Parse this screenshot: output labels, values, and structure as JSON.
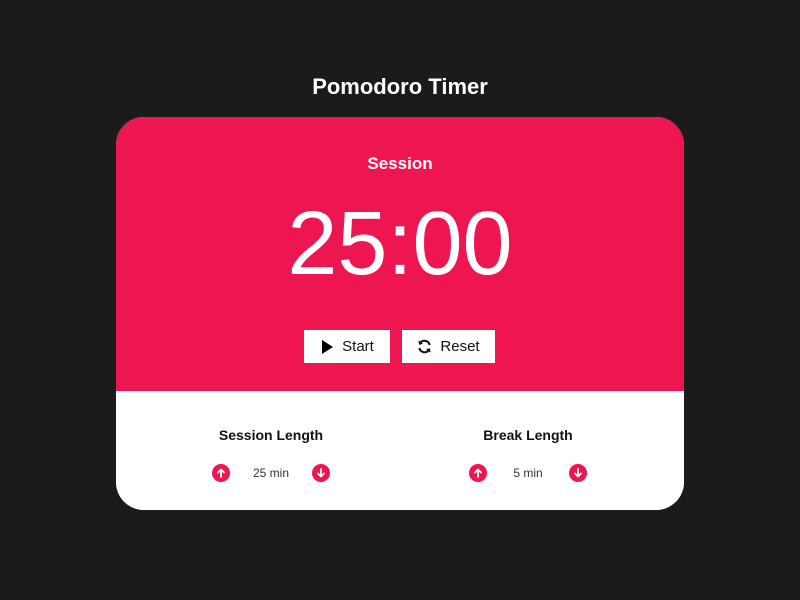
{
  "app": {
    "title": "Pomodoro Timer"
  },
  "timer": {
    "label": "Session",
    "display": "25:00",
    "start_label": "Start",
    "reset_label": "Reset"
  },
  "settings": {
    "session": {
      "title": "Session Length",
      "value": "25 min"
    },
    "break": {
      "title": "Break Length",
      "value": "5 min"
    }
  },
  "colors": {
    "accent": "#ee1650",
    "background": "#1b1b1b",
    "panel": "#ffffff"
  },
  "icons": {
    "start": "play-icon",
    "reset": "refresh-icon",
    "increment": "arrow-up-circle-icon",
    "decrement": "arrow-down-circle-icon"
  }
}
